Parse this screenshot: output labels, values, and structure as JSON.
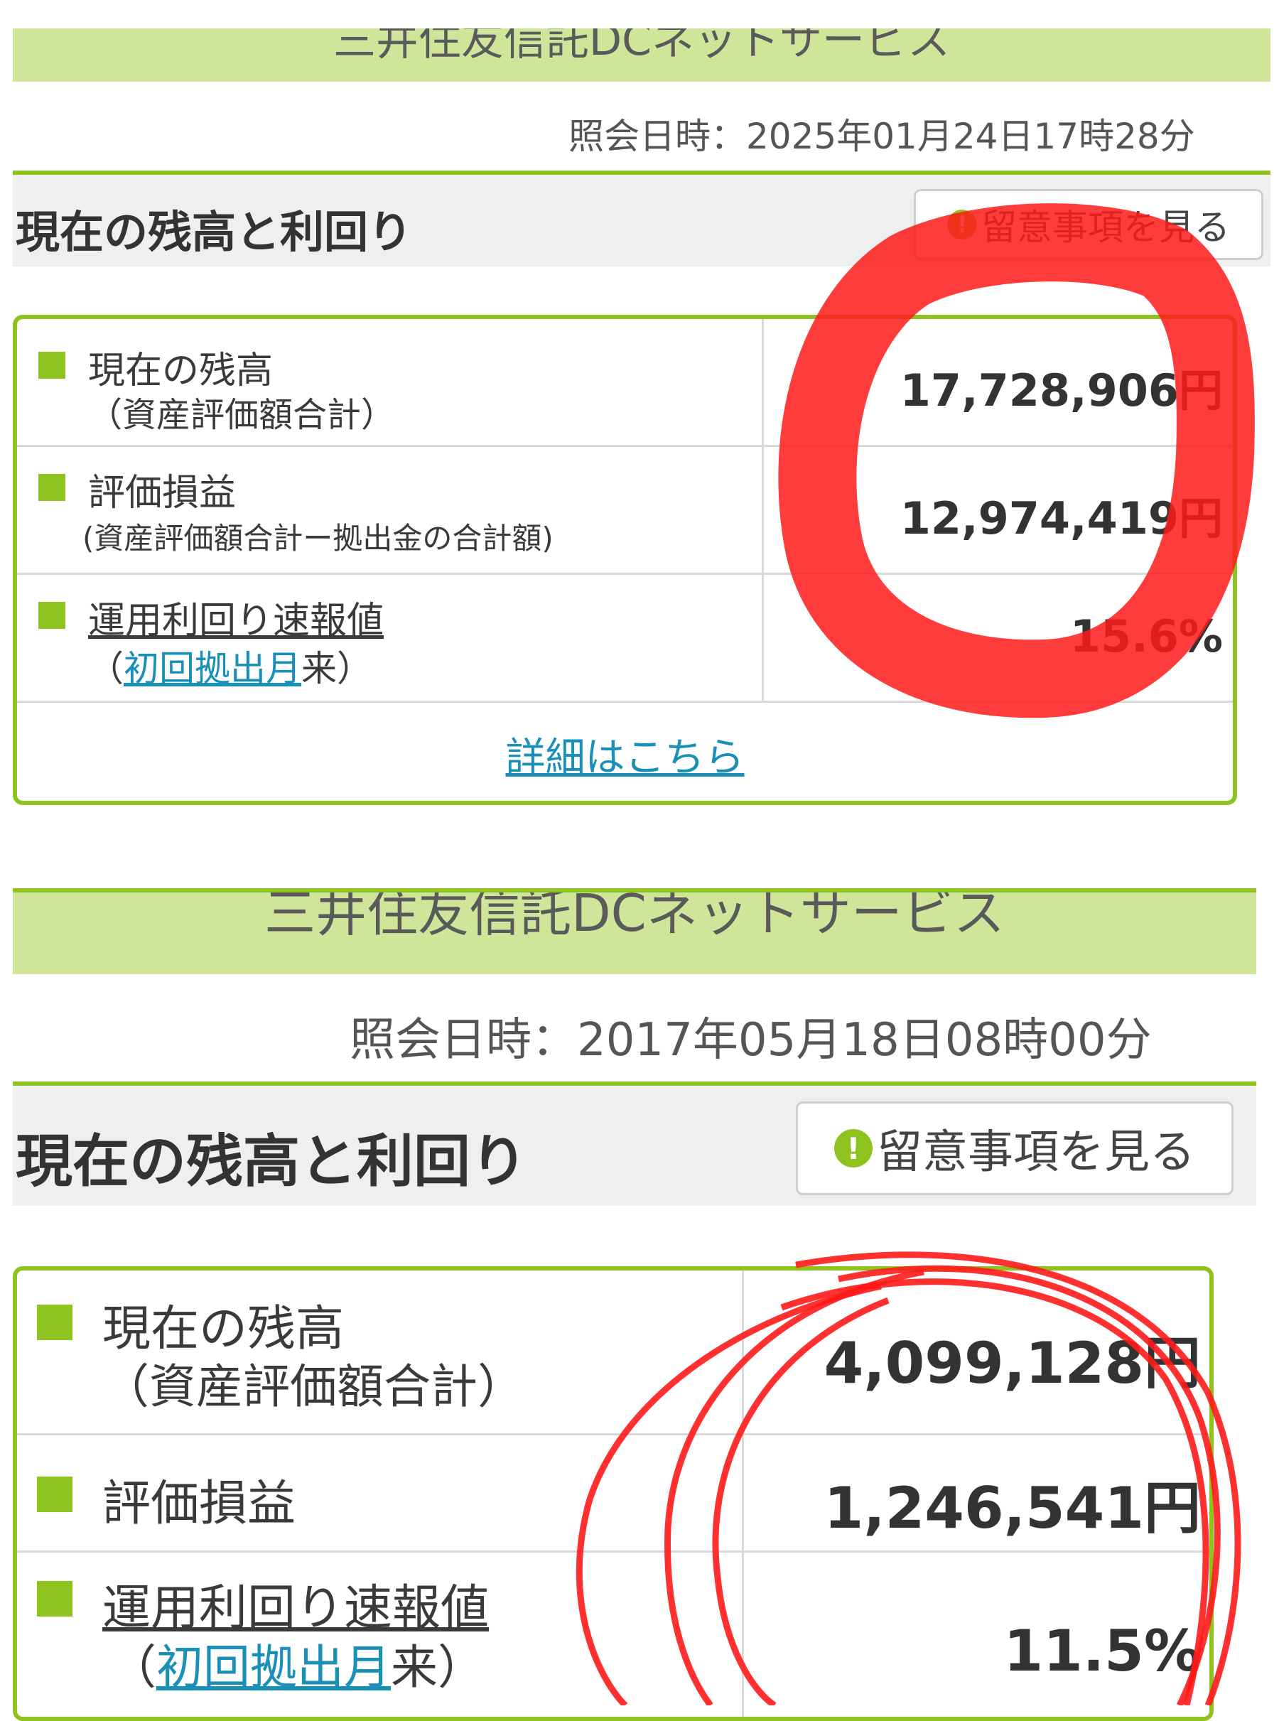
{
  "top": {
    "banner_text": "三井住友信託DCネットサービス",
    "timestamp": "照会日時：2025年01月24日17時28分",
    "section_title": "現在の残高と利回り",
    "notice_button": "留意事項を見る",
    "rows": [
      {
        "label": "現在の残高",
        "sub": "（資産評価額合計）",
        "value": "17,728,906円"
      },
      {
        "label": "評価損益",
        "sub": "(資産評価額合計ー拠出金の合計額)",
        "value": "12,974,419円"
      },
      {
        "label_link": "運用利回り速報値",
        "sub_open": "（",
        "sub_link": "初回拠出月",
        "sub_close": "来）",
        "value": "15.6%"
      }
    ],
    "detail_link": "詳細はこちら"
  },
  "bottom": {
    "banner_text": "三井住友信託DCネットサービス",
    "timestamp": "照会日時：2017年05月18日08時00分",
    "section_title": "現在の残高と利回り",
    "notice_button": "留意事項を見る",
    "rows": [
      {
        "label": "現在の残高",
        "sub": "（資産評価額合計）",
        "value": "4,099,128円"
      },
      {
        "label": "評価損益",
        "value": "1,246,541円"
      },
      {
        "label_link": "運用利回り速報値",
        "sub_open": "（",
        "sub_link": "初回拠出月",
        "sub_close": "来）",
        "value": "11.5%"
      }
    ]
  },
  "colors": {
    "accent_green": "#8dc21f",
    "link_blue": "#1a8fb8",
    "scribble_red": "#ff1a1a"
  },
  "icons": [
    "exclamation-circle-icon",
    "green-square-bullet-icon"
  ]
}
